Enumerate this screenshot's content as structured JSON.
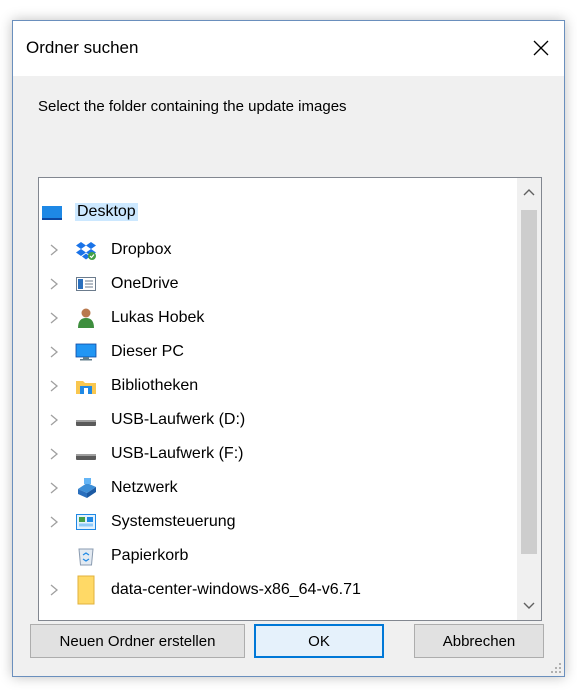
{
  "window": {
    "title": "Ordner suchen"
  },
  "prompt": "Select the folder containing the update images",
  "tree": {
    "root": {
      "label": "Desktop",
      "icon": "desktop-icon",
      "selected": true
    },
    "items": [
      {
        "label": "Dropbox",
        "icon": "dropbox-icon",
        "expandable": true
      },
      {
        "label": "OneDrive",
        "icon": "onedrive-icon",
        "expandable": true
      },
      {
        "label": "Lukas Hobek",
        "icon": "user-folder-icon",
        "expandable": true
      },
      {
        "label": "Dieser PC",
        "icon": "computer-icon",
        "expandable": true
      },
      {
        "label": "Bibliotheken",
        "icon": "libraries-icon",
        "expandable": true
      },
      {
        "label": "USB-Laufwerk (D:)",
        "icon": "drive-icon",
        "expandable": true
      },
      {
        "label": "USB-Laufwerk (F:)",
        "icon": "drive-icon",
        "expandable": true
      },
      {
        "label": "Netzwerk",
        "icon": "network-icon",
        "expandable": true
      },
      {
        "label": "Systemsteuerung",
        "icon": "control-panel-icon",
        "expandable": true
      },
      {
        "label": "Papierkorb",
        "icon": "recycle-bin-icon",
        "expandable": false
      },
      {
        "label": "data-center-windows-x86_64-v6.71",
        "icon": "folder-icon",
        "expandable": true
      }
    ]
  },
  "buttons": {
    "new_folder": "Neuen Ordner erstellen",
    "ok": "OK",
    "cancel": "Abbrechen"
  },
  "colors": {
    "selection": "#cce8ff",
    "default_button_border": "#0078d7"
  }
}
